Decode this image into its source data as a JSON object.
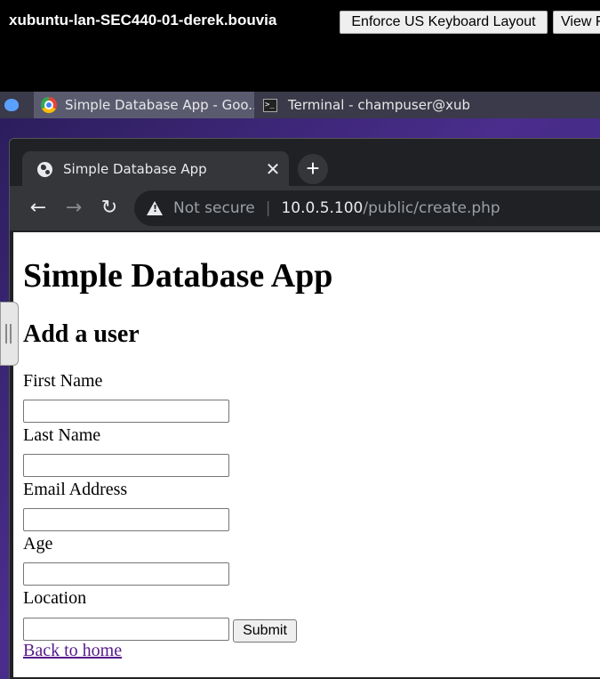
{
  "console": {
    "vm_name": "xubuntu-lan-SEC440-01-derek.bouvia",
    "enforce_button": "Enforce US Keyboard Layout",
    "view_button": "View Fullscreen"
  },
  "taskbar": {
    "tasks": [
      {
        "label": "Simple Database App - Goo...",
        "icon": "chrome-icon",
        "active": true
      },
      {
        "label": "Terminal - champuser@xub...",
        "icon": "terminal-icon",
        "active": false
      }
    ]
  },
  "browser": {
    "tab_title": "Simple Database App",
    "address": {
      "security": "Not secure",
      "separator": "|",
      "host": "10.0.5.100",
      "path": "/public/create.php"
    }
  },
  "page": {
    "title": "Simple Database App",
    "subtitle": "Add a user",
    "fields": [
      {
        "label": "First Name",
        "value": ""
      },
      {
        "label": "Last Name",
        "value": ""
      },
      {
        "label": "Email Address",
        "value": ""
      },
      {
        "label": "Age",
        "value": ""
      },
      {
        "label": "Location",
        "value": ""
      }
    ],
    "submit_label": "Submit",
    "back_link": "Back to home"
  },
  "colors": {
    "link_visited": "#551a8b",
    "desktop_bg": "#4a2d8c",
    "chrome_dark": "#202124"
  }
}
